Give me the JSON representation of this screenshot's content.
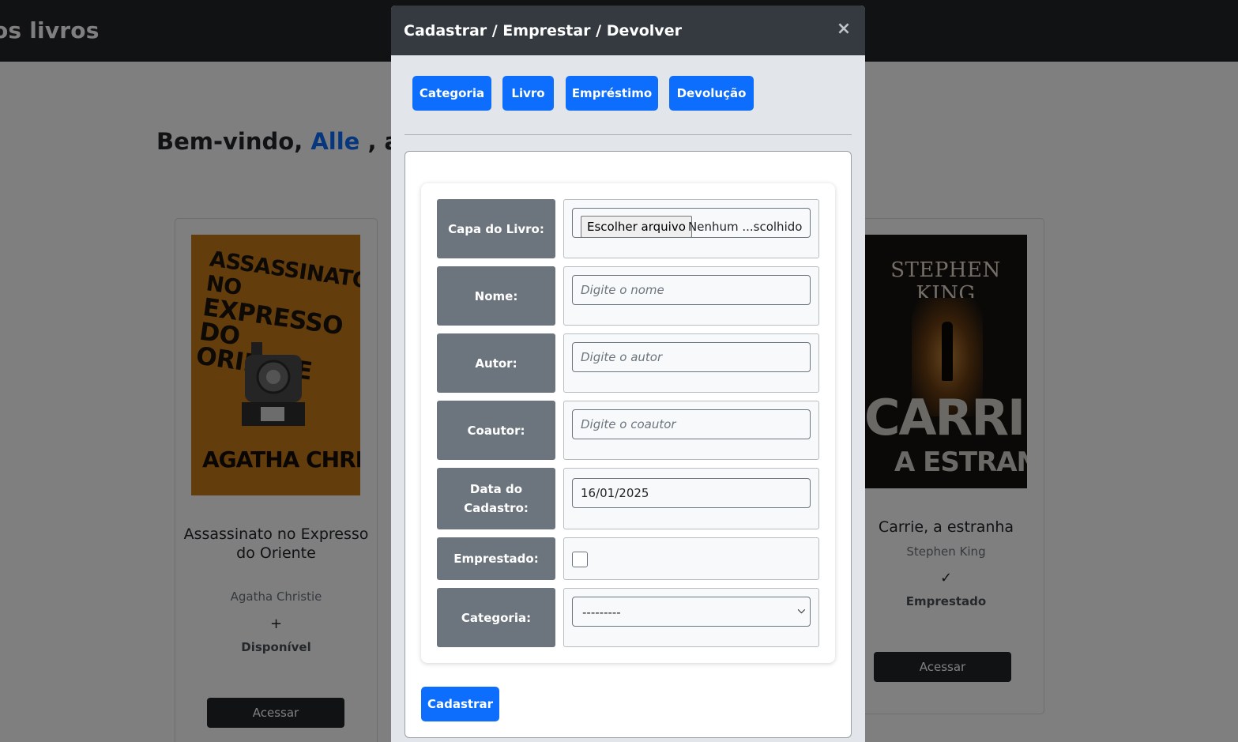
{
  "navbar": {
    "brand": "os livros"
  },
  "welcome": {
    "prefix": "Bem-vindo,",
    "user": "Alle",
    "suffix": ", aqu"
  },
  "books": [
    {
      "cover": {
        "title_line1": "ASSASSINATO NO",
        "title_line2": "EXPRESSO DO ORIENTE",
        "author": "AGATHA CHRISTIE"
      },
      "title": "Assassinato no Expresso do Oriente",
      "author": "Agatha Christie",
      "status_icon": "+",
      "status": "Disponível",
      "action": "Acessar"
    },
    {
      "cover": {
        "author": "STEPHEN KING",
        "title": "CARRIE",
        "subtitle": "A ESTRANHA"
      },
      "title": "Carrie, a estranha",
      "author": "Stephen King",
      "status_icon": "✓",
      "status": "Emprestado",
      "action": "Acessar"
    }
  ],
  "modal": {
    "title": "Cadastrar / Emprestar / Devolver",
    "close": "×",
    "tabs": [
      "Categoria",
      "Livro",
      "Empréstimo",
      "Devolução"
    ],
    "form": {
      "capa_label": "Capa do Livro:",
      "file_button": "Escolher arquivo",
      "file_name": "Nenhum ...scolhido",
      "nome_label": "Nome:",
      "nome_placeholder": "Digite o nome",
      "autor_label": "Autor:",
      "autor_placeholder": "Digite o autor",
      "coautor_label": "Coautor:",
      "coautor_placeholder": "Digite o coautor",
      "data_label_1": "Data do",
      "data_label_2": "Cadastro:",
      "data_value": "16/01/2025",
      "emprestado_label": "Emprestado:",
      "emprestado_checked": false,
      "categoria_label": "Categoria:",
      "categoria_selected": "---------",
      "submit": "Cadastrar"
    }
  },
  "colors": {
    "primary": "#0d6efd",
    "dark": "#212529",
    "label_bg": "#6c757d",
    "modal_header": "#343a40"
  }
}
